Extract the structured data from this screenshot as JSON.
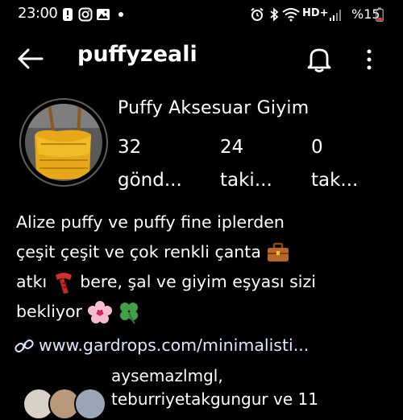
{
  "status_bar": {
    "time": "23:00",
    "network_label": "HD+",
    "battery_text": "%15",
    "left_icons": [
      "alert-icon",
      "instagram-icon",
      "gallery-icon",
      "dot-icon"
    ],
    "right_icons": [
      "alarm-icon",
      "bluetooth-icon",
      "wifi-icon",
      "signal-icon",
      "battery-icon"
    ]
  },
  "header": {
    "username": "puffyzeali",
    "icons": [
      "back-arrow-icon",
      "bell-icon",
      "more-vertical-icon"
    ]
  },
  "profile": {
    "display_name": "Puffy Aksesuar Giyim",
    "stats": [
      {
        "value": "32",
        "label": "gönd..."
      },
      {
        "value": "24",
        "label": "taki..."
      },
      {
        "value": "0",
        "label": "tak..."
      }
    ],
    "bio_lines": [
      "Alize puffy ve puffy fine iplerden",
      "çeşit çeşit ve çok renkli çanta",
      "atkı",
      "bere, şal ve giyim eşyası sizi",
      "bekliyor"
    ],
    "link": "www.gardrops.com/minimalisti...",
    "followed_by_line1": "aysemazlmgl,",
    "followed_by_line2": "teburriyetakgungur ve 11"
  },
  "colors": {
    "background": "#000000",
    "text": "#ffffff",
    "link": "#dbe6ff"
  }
}
